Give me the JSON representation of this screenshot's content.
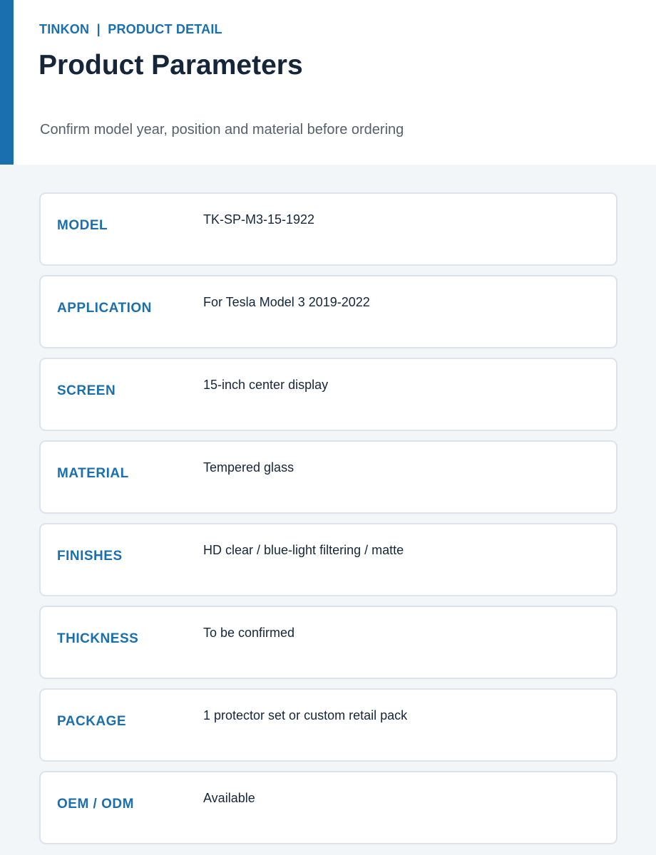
{
  "header": {
    "brand": "TINKON",
    "separator": "|",
    "section": "PRODUCT DETAIL",
    "title": "Product Parameters",
    "subtitle": "Confirm model year, position and material before ordering"
  },
  "specs": [
    {
      "label": "MODEL",
      "value": "TK-SP-M3-15-1922"
    },
    {
      "label": "APPLICATION",
      "value": "For Tesla Model 3 2019-2022"
    },
    {
      "label": "SCREEN",
      "value": "15-inch center display"
    },
    {
      "label": "MATERIAL",
      "value": "Tempered glass"
    },
    {
      "label": "FINISHES",
      "value": "HD clear / blue-light filtering / matte"
    },
    {
      "label": "THICKNESS",
      "value": "To be confirmed"
    },
    {
      "label": "PACKAGE",
      "value": "1 protector set or custom retail pack"
    },
    {
      "label": "OEM / ODM",
      "value": "Available"
    }
  ],
  "colors": {
    "accent": "#1a6fae",
    "title": "#15253a",
    "subtitle": "#56606c",
    "background": "#f2f6f9",
    "card_border": "#dce3ea"
  }
}
